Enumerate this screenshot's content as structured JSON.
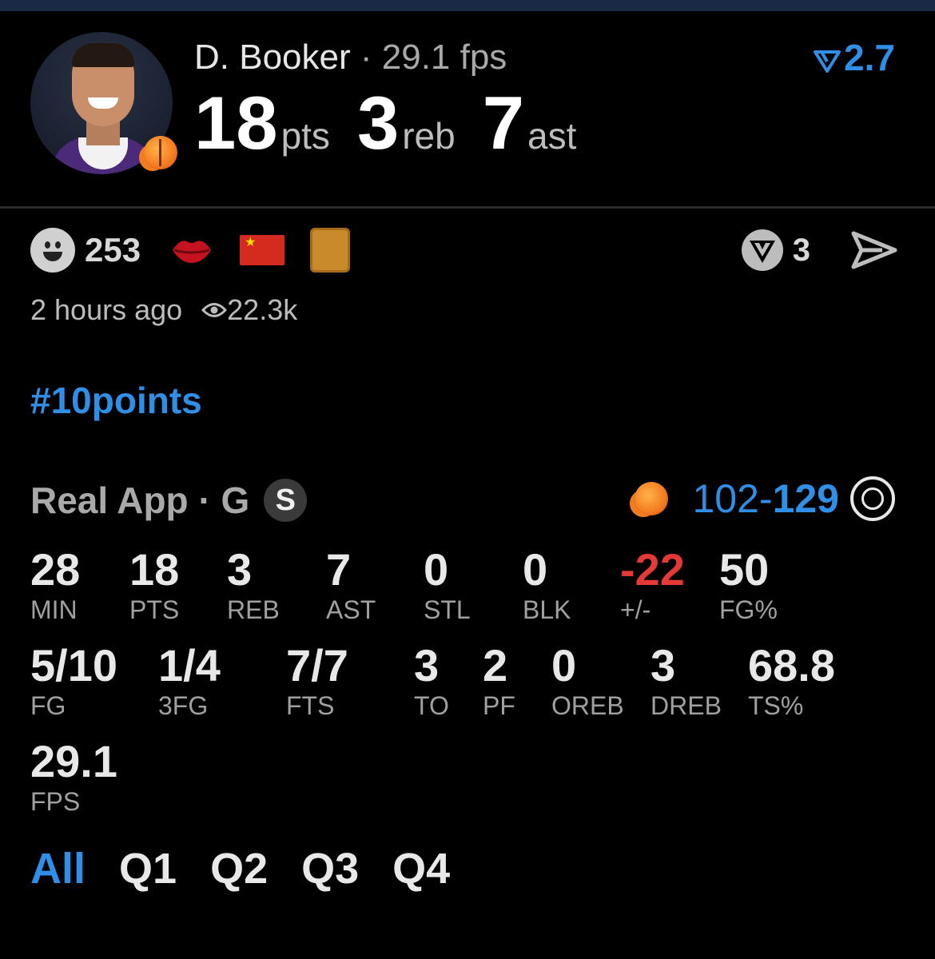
{
  "colors": {
    "accent_blue": "#2f8fe6",
    "negative_red": "#e53935",
    "background": "#000000"
  },
  "header": {
    "player_name": "D. Booker",
    "fps_label": "· 29.1 fps",
    "fps_delta": "2.7",
    "points": "18",
    "points_unit": "pts",
    "rebounds": "3",
    "rebounds_unit": "reb",
    "assists": "7",
    "assists_unit": "ast"
  },
  "reactions": {
    "count": "253",
    "icons": [
      "smiley-icon",
      "lips-icon",
      "china-flag-icon",
      "book-icon"
    ],
    "votes": "3"
  },
  "meta": {
    "time_ago": "2 hours ago",
    "views": "22.3k"
  },
  "hashtag": "#10points",
  "game": {
    "source": "Real App",
    "position": "· G",
    "starter_badge": "S",
    "score_home": "102",
    "score_sep": "-",
    "score_away": "129"
  },
  "stats_row1": [
    {
      "value": "28",
      "label": "MIN"
    },
    {
      "value": "18",
      "label": "PTS"
    },
    {
      "value": "3",
      "label": "REB"
    },
    {
      "value": "7",
      "label": "AST"
    },
    {
      "value": "0",
      "label": "STL"
    },
    {
      "value": "0",
      "label": "BLK"
    },
    {
      "value": "-22",
      "label": "+/-"
    },
    {
      "value": "50",
      "label": "FG%"
    }
  ],
  "stats_row2": [
    {
      "value": "5/10",
      "label": "FG"
    },
    {
      "value": "1/4",
      "label": "3FG"
    },
    {
      "value": "7/7",
      "label": "FTS"
    },
    {
      "value": "3",
      "label": "TO"
    },
    {
      "value": "2",
      "label": "PF"
    },
    {
      "value": "0",
      "label": "OREB"
    },
    {
      "value": "3",
      "label": "DREB"
    },
    {
      "value": "68.8",
      "label": "TS%"
    }
  ],
  "stats_row3": [
    {
      "value": "29.1",
      "label": "FPS"
    }
  ],
  "tabs": [
    "All",
    "Q1",
    "Q2",
    "Q3",
    "Q4"
  ],
  "active_tab": "All"
}
